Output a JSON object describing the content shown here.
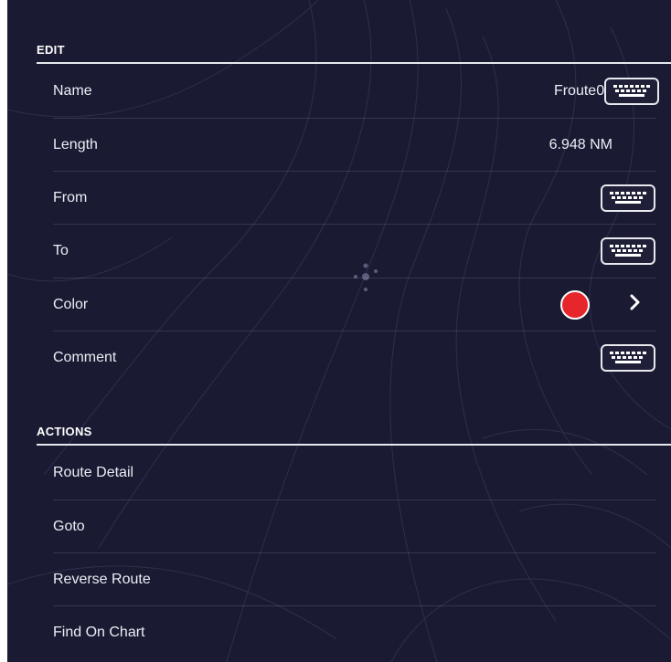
{
  "edit_section": {
    "header": "EDIT",
    "name": {
      "label": "Name",
      "value": "Froute02",
      "icon": "keyboard-icon"
    },
    "length": {
      "label": "Length",
      "value": "6.948 NM"
    },
    "from": {
      "label": "From",
      "icon": "keyboard-icon"
    },
    "to": {
      "label": "To",
      "icon": "keyboard-icon"
    },
    "color": {
      "label": "Color",
      "swatch": "#e6262b",
      "icon": "chevron-right-icon"
    },
    "comment": {
      "label": "Comment",
      "icon": "keyboard-icon"
    }
  },
  "actions_section": {
    "header": "ACTIONS",
    "items": [
      {
        "label": "Route Detail"
      },
      {
        "label": "Goto"
      },
      {
        "label": "Reverse Route"
      },
      {
        "label": "Find On Chart"
      }
    ]
  },
  "colors": {
    "background": "#1a1b33",
    "text": "#ecedf4",
    "route_color": "#e6262b"
  }
}
